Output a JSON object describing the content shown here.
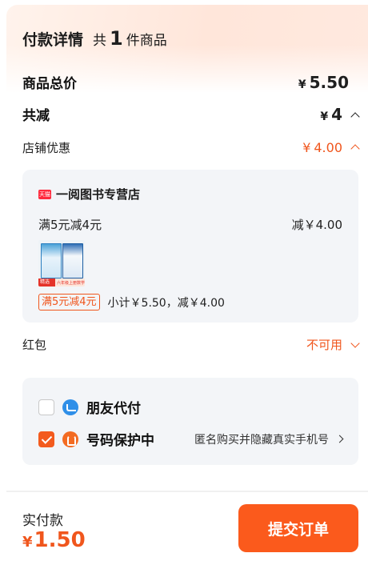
{
  "header": {
    "title": "付款详情",
    "count_prefix": "共",
    "count": "1",
    "count_suffix": "件商品"
  },
  "total": {
    "label": "商品总价",
    "currency": "¥",
    "amount": "5.50"
  },
  "reduction": {
    "label": "共减",
    "currency": "¥",
    "amount": "4"
  },
  "shop_discount": {
    "label": "店铺优惠",
    "currency": "¥",
    "amount": "4.00"
  },
  "shop": {
    "badge": "天猫",
    "name": "一阅图书专营店",
    "promo_label": "满5元减4元",
    "promo_amount": "减￥4.00",
    "product_strip_left": "精选版",
    "product_strip_right": "六年级上册数学",
    "tag": "满5元减4元",
    "subtotal": "小计￥5.50，减￥4.00"
  },
  "red_packet": {
    "label": "红包",
    "status": "不可用"
  },
  "payment_options": [
    {
      "label": "朋友代付",
      "icon": "friend-pay-icon",
      "checked": false
    },
    {
      "label": "号码保护中",
      "icon": "phone-protect-icon",
      "checked": true,
      "hint": "匿名购买并隐藏真实手机号"
    }
  ],
  "footer": {
    "label": "实付款",
    "currency": "¥",
    "amount": "1.50",
    "submit_label": "提交订单"
  },
  "colors": {
    "accent": "#f0561d",
    "card": "#f3f5f8",
    "submit": "#fb5a1c"
  }
}
